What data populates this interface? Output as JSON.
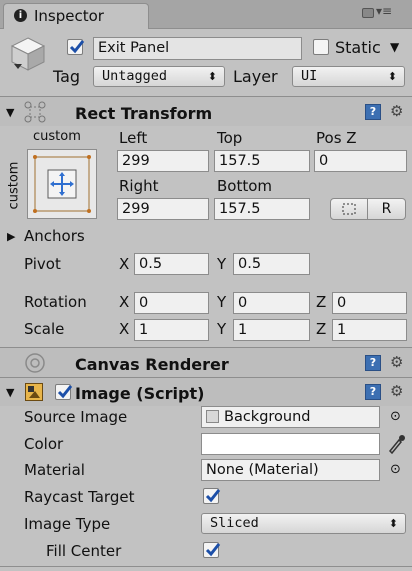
{
  "tab": {
    "title": "Inspector"
  },
  "gameobject": {
    "name": "Exit Panel",
    "static_label": "Static",
    "tag_label": "Tag",
    "tag_value": "Untagged",
    "layer_label": "Layer",
    "layer_value": "UI"
  },
  "rect_transform": {
    "title": "Rect Transform",
    "anchor_preset_top": "custom",
    "anchor_preset_side": "custom",
    "left_label": "Left",
    "left_value": "299",
    "top_label": "Top",
    "top_value": "157.5",
    "posz_label": "Pos Z",
    "posz_value": "0",
    "right_label": "Right",
    "right_value": "299",
    "bottom_label": "Bottom",
    "bottom_value": "157.5",
    "raw_button": "R",
    "anchors_label": "Anchors",
    "pivot_label": "Pivot",
    "pivot_x": "0.5",
    "pivot_y": "0.5",
    "rotation_label": "Rotation",
    "rot_x": "0",
    "rot_y": "0",
    "rot_z": "0",
    "scale_label": "Scale",
    "scale_x": "1",
    "scale_y": "1",
    "scale_z": "1",
    "x": "X",
    "y": "Y",
    "z": "Z"
  },
  "canvas_renderer": {
    "title": "Canvas Renderer"
  },
  "image": {
    "title": "Image (Script)",
    "source_image_label": "Source Image",
    "source_image_value": "Background",
    "color_label": "Color",
    "color_value": "#ffffff",
    "material_label": "Material",
    "material_value": "None (Material)",
    "raycast_label": "Raycast Target",
    "image_type_label": "Image Type",
    "image_type_value": "Sliced",
    "fill_center_label": "Fill Center"
  },
  "colors": {
    "help_icon": "#3c6fb2",
    "panel_bg": "#c2c2c2",
    "header_bg": "#bdbdbd"
  }
}
